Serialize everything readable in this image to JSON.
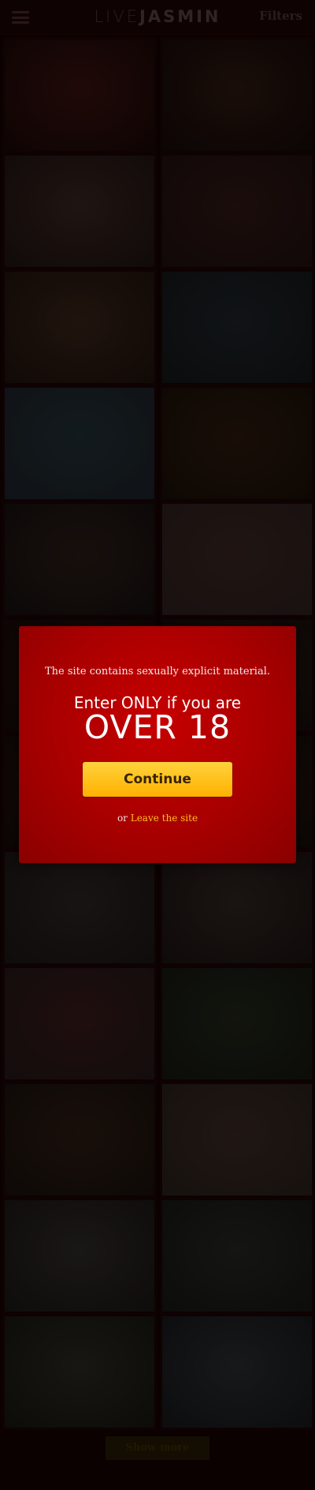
{
  "header": {
    "logo_live": "LIVE",
    "logo_jasmin": "JASMIN",
    "filters_label": "Filters"
  },
  "models": [
    {
      "c1": "#3a1210",
      "c2": "#1a0807"
    },
    {
      "c1": "#2f1911",
      "c2": "#150a08"
    },
    {
      "c1": "#3a2620",
      "c2": "#1e1410"
    },
    {
      "c1": "#311815",
      "c2": "#201010"
    },
    {
      "c1": "#3b2418",
      "c2": "#1e120c"
    },
    {
      "c1": "#1f2428",
      "c2": "#141718"
    },
    {
      "c1": "#223036",
      "c2": "#1d2229"
    },
    {
      "c1": "#2d1a0c",
      "c2": "#1a0f08"
    },
    {
      "c1": "#2a1c16",
      "c2": "#171010"
    },
    {
      "c1": "#3a2621",
      "c2": "#2e211e"
    },
    {
      "c1": "#2a1410",
      "c2": "#160a08"
    },
    {
      "c1": "#281a14",
      "c2": "#180e0c"
    },
    {
      "c1": "#26160f",
      "c2": "#150b08"
    },
    {
      "c1": "#2a1812",
      "c2": "#160c09"
    },
    {
      "c1": "#2e2424",
      "c2": "#1c1616"
    },
    {
      "c1": "#302520",
      "c2": "#1c1412"
    },
    {
      "c1": "#3a1a1a",
      "c2": "#241818"
    },
    {
      "c1": "#22251a",
      "c2": "#161810"
    },
    {
      "c1": "#2c1c14",
      "c2": "#1a110c"
    },
    {
      "c1": "#3a2a22",
      "c2": "#2a201c"
    },
    {
      "c1": "#2f2b28",
      "c2": "#1a1716"
    },
    {
      "c1": "#262824",
      "c2": "#171814"
    },
    {
      "c1": "#2b2a22",
      "c2": "#17160f"
    },
    {
      "c1": "#2c2d30",
      "c2": "#17181a"
    }
  ],
  "show_more_label": "Show more",
  "age_gate": {
    "warning": "The site contains sexually explicit material.",
    "enter_only": "Enter ONLY if you are",
    "over_18": "OVER 18",
    "continue_label": "Continue",
    "or_text": "or",
    "leave_label": "Leave the site"
  }
}
